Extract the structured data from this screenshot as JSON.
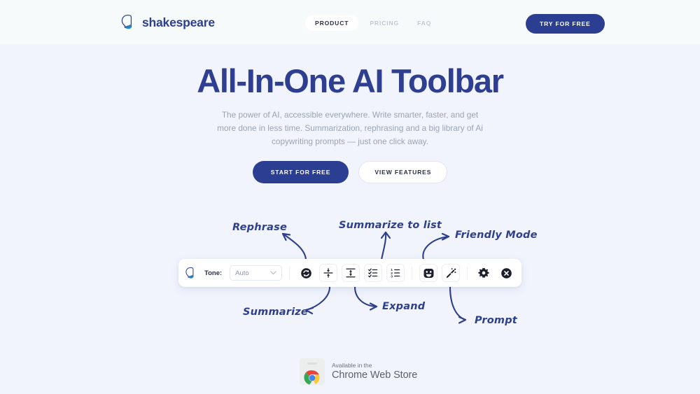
{
  "header": {
    "brand_name": "shakespeare",
    "brand_icon": "shakespeare-head-logo",
    "nav": [
      {
        "label": "PRODUCT",
        "active": true
      },
      {
        "label": "PRICING",
        "active": false
      },
      {
        "label": "FAQ",
        "active": false
      }
    ],
    "cta_label": "TRY FOR FREE"
  },
  "hero": {
    "title": "All-In-One AI Toolbar",
    "subtitle": "The power of AI, accessible everywhere. Write smarter, faster, and get more done in less time. Summarization, rephrasing and a big library of Ai copywriting prompts — just one click away.",
    "primary_cta": "START FOR FREE",
    "secondary_cta": "VIEW FEATURES"
  },
  "annotations": [
    {
      "label": "Rephrase",
      "position": "top-left"
    },
    {
      "label": "Summarize to list",
      "position": "top-center"
    },
    {
      "label": "Friendly Mode",
      "position": "top-right"
    },
    {
      "label": "Summarize",
      "position": "bottom-left"
    },
    {
      "label": "Expand",
      "position": "bottom-center"
    },
    {
      "label": "Prompt",
      "position": "bottom-right"
    }
  ],
  "toolbar": {
    "logo_icon": "shakespeare-head-logo",
    "tone_label": "Tone:",
    "tone_value": "Auto",
    "tone_options": [
      "Auto"
    ],
    "buttons": [
      {
        "name": "rephrase-button",
        "icon": "refresh-circle-icon"
      },
      {
        "name": "summarize-button",
        "icon": "compress-arrows-icon"
      },
      {
        "name": "expand-button",
        "icon": "expand-arrows-icon"
      },
      {
        "name": "summarize-to-list-button",
        "icon": "checklist-icon"
      },
      {
        "name": "numbered-list-button",
        "icon": "numbered-list-icon"
      },
      {
        "name": "friendly-mode-button",
        "icon": "smiley-face-icon"
      },
      {
        "name": "prompt-button",
        "icon": "magic-wand-icon"
      },
      {
        "name": "settings-button",
        "icon": "gear-icon"
      },
      {
        "name": "close-button",
        "icon": "close-circle-icon"
      }
    ]
  },
  "chrome_badge": {
    "top_line": "Available in the",
    "main_line": "Chrome Web Store",
    "icon": "chrome-logo-icon"
  },
  "colors": {
    "brand_navy": "#2c3e91",
    "page_bg": "#f1f4fd",
    "header_bg": "#f7fafb",
    "muted_text": "#9ba3b4",
    "annotation": "#2e3f8b"
  }
}
